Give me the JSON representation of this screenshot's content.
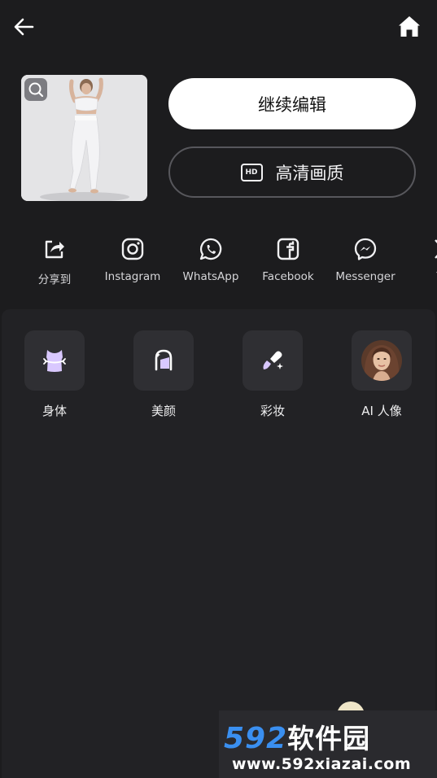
{
  "actions": {
    "continue_edit": "继续编辑",
    "hd_quality": "高清画质",
    "hd_badge": "HD"
  },
  "share": {
    "items": [
      {
        "label": "分享到",
        "icon": "share-icon"
      },
      {
        "label": "Instagram",
        "icon": "instagram-icon"
      },
      {
        "label": "WhatsApp",
        "icon": "whatsapp-icon"
      },
      {
        "label": "Facebook",
        "icon": "facebook-icon"
      },
      {
        "label": "Messenger",
        "icon": "messenger-icon"
      },
      {
        "label": "Tw",
        "icon": "twitter-icon"
      }
    ]
  },
  "tools": {
    "items": [
      {
        "label": "身体",
        "icon": "body-icon"
      },
      {
        "label": "美颜",
        "icon": "beauty-face-icon"
      },
      {
        "label": "彩妆",
        "icon": "makeup-brush-icon"
      },
      {
        "label": "AI 人像",
        "icon": "ai-portrait-avatar"
      }
    ]
  },
  "watermark": {
    "brand": "592",
    "brand_cn": "软件园",
    "url": "www.592xiazai.com"
  },
  "colors": {
    "background": "#1c1c1e",
    "panel": "#222225",
    "tool_tile": "#2f2f33",
    "accent_purple": "#d9c8ff",
    "watermark_blue": "#3a8ff0"
  }
}
